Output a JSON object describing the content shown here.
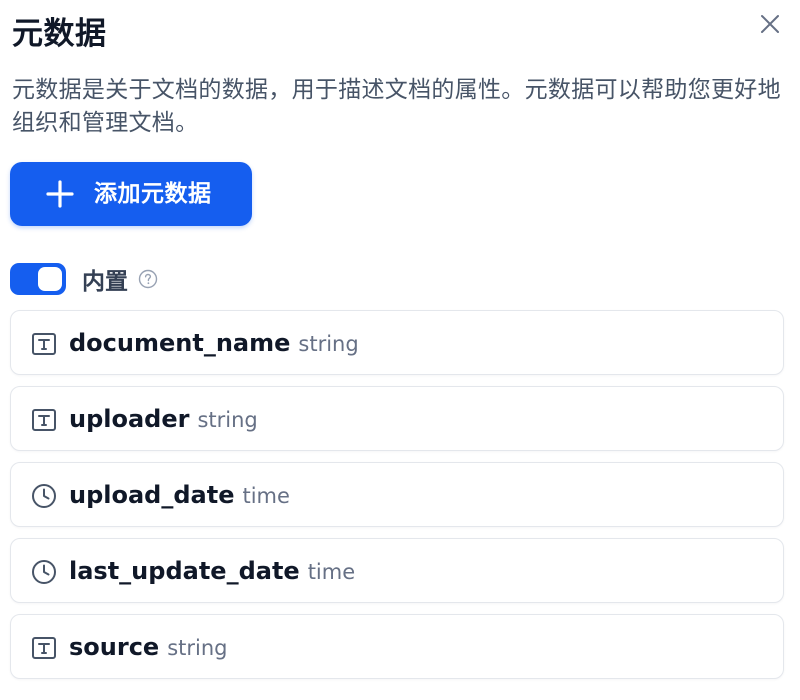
{
  "dialog": {
    "title": "元数据",
    "description": "元数据是关于文档的数据，用于描述文档的属性。元数据可以帮助您更好地组织和管理文档。",
    "close_icon": "close-icon"
  },
  "actions": {
    "add_label": "添加元数据",
    "add_icon": "plus-icon"
  },
  "builtin": {
    "label": "内置",
    "enabled": true,
    "help_icon": "question-circle-icon"
  },
  "metadata": [
    {
      "name": "document_name",
      "type": "string",
      "icon": "text-type-icon"
    },
    {
      "name": "uploader",
      "type": "string",
      "icon": "text-type-icon"
    },
    {
      "name": "upload_date",
      "type": "time",
      "icon": "clock-icon"
    },
    {
      "name": "last_update_date",
      "type": "time",
      "icon": "clock-icon"
    },
    {
      "name": "source",
      "type": "string",
      "icon": "text-type-icon"
    }
  ],
  "colors": {
    "accent": "#155eef",
    "text_primary": "#101828",
    "text_secondary": "#475467",
    "text_muted": "#667085",
    "border": "#e4e7ec"
  }
}
